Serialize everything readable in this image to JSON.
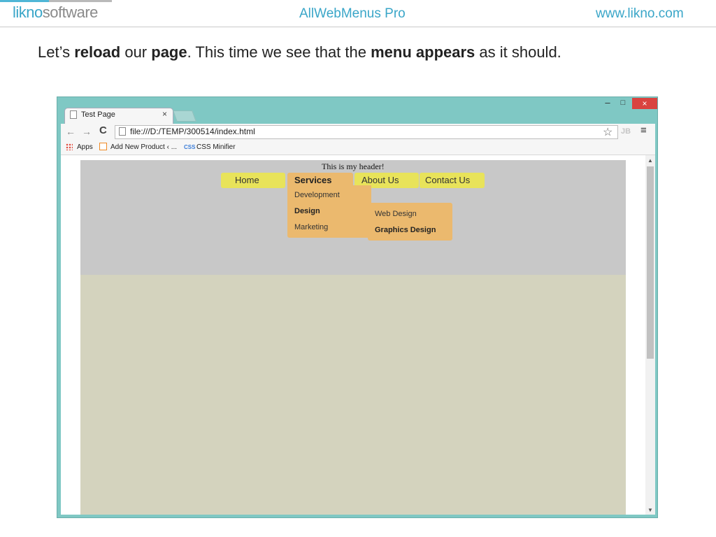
{
  "slide": {
    "logo_part1": "likno",
    "logo_part2": "software",
    "product": "AllWebMenus Pro",
    "url": "www.likno.com",
    "instruction": {
      "t1": "Let’s ",
      "b1": "reload",
      "t2": " our ",
      "b2": "page",
      "t3": ". This time we see that the ",
      "b3": "menu appears",
      "t4": " as it should."
    }
  },
  "browser": {
    "window_controls": {
      "minimize": "–",
      "maximize": "□",
      "close": "×"
    },
    "tab": {
      "title": "Test Page",
      "close": "×"
    },
    "toolbar": {
      "back": "←",
      "forward": "→",
      "reload": "C",
      "url": "file:///D:/TEMP/300514/index.html",
      "star": "☆",
      "extension": "JB",
      "menu": "≡"
    },
    "bookmarks": [
      {
        "label": "Apps"
      },
      {
        "label": "Add New Product ‹ ..."
      },
      {
        "label": "CSS Minifier",
        "icon_text": "CSS"
      }
    ],
    "scroll": {
      "up": "▲",
      "down": "▼"
    }
  },
  "page": {
    "header_text": "This is my header!",
    "menu": [
      {
        "label": "Home"
      },
      {
        "label": "Services"
      },
      {
        "label": "About Us"
      },
      {
        "label": "Contact Us"
      }
    ],
    "services_submenu": [
      "Development",
      "Design",
      "Marketing"
    ],
    "design_submenu": [
      "Web Design",
      "Graphics Design"
    ]
  },
  "colors": {
    "accent": "#3aa6c8",
    "menu_item": "#e8e35a",
    "menu_active": "#ebb96e",
    "page_header_bg": "#c8c8c8",
    "page_body_bg": "#d4d3be",
    "browser_frame": "#7fc8c4",
    "close_button": "#d9433f"
  }
}
